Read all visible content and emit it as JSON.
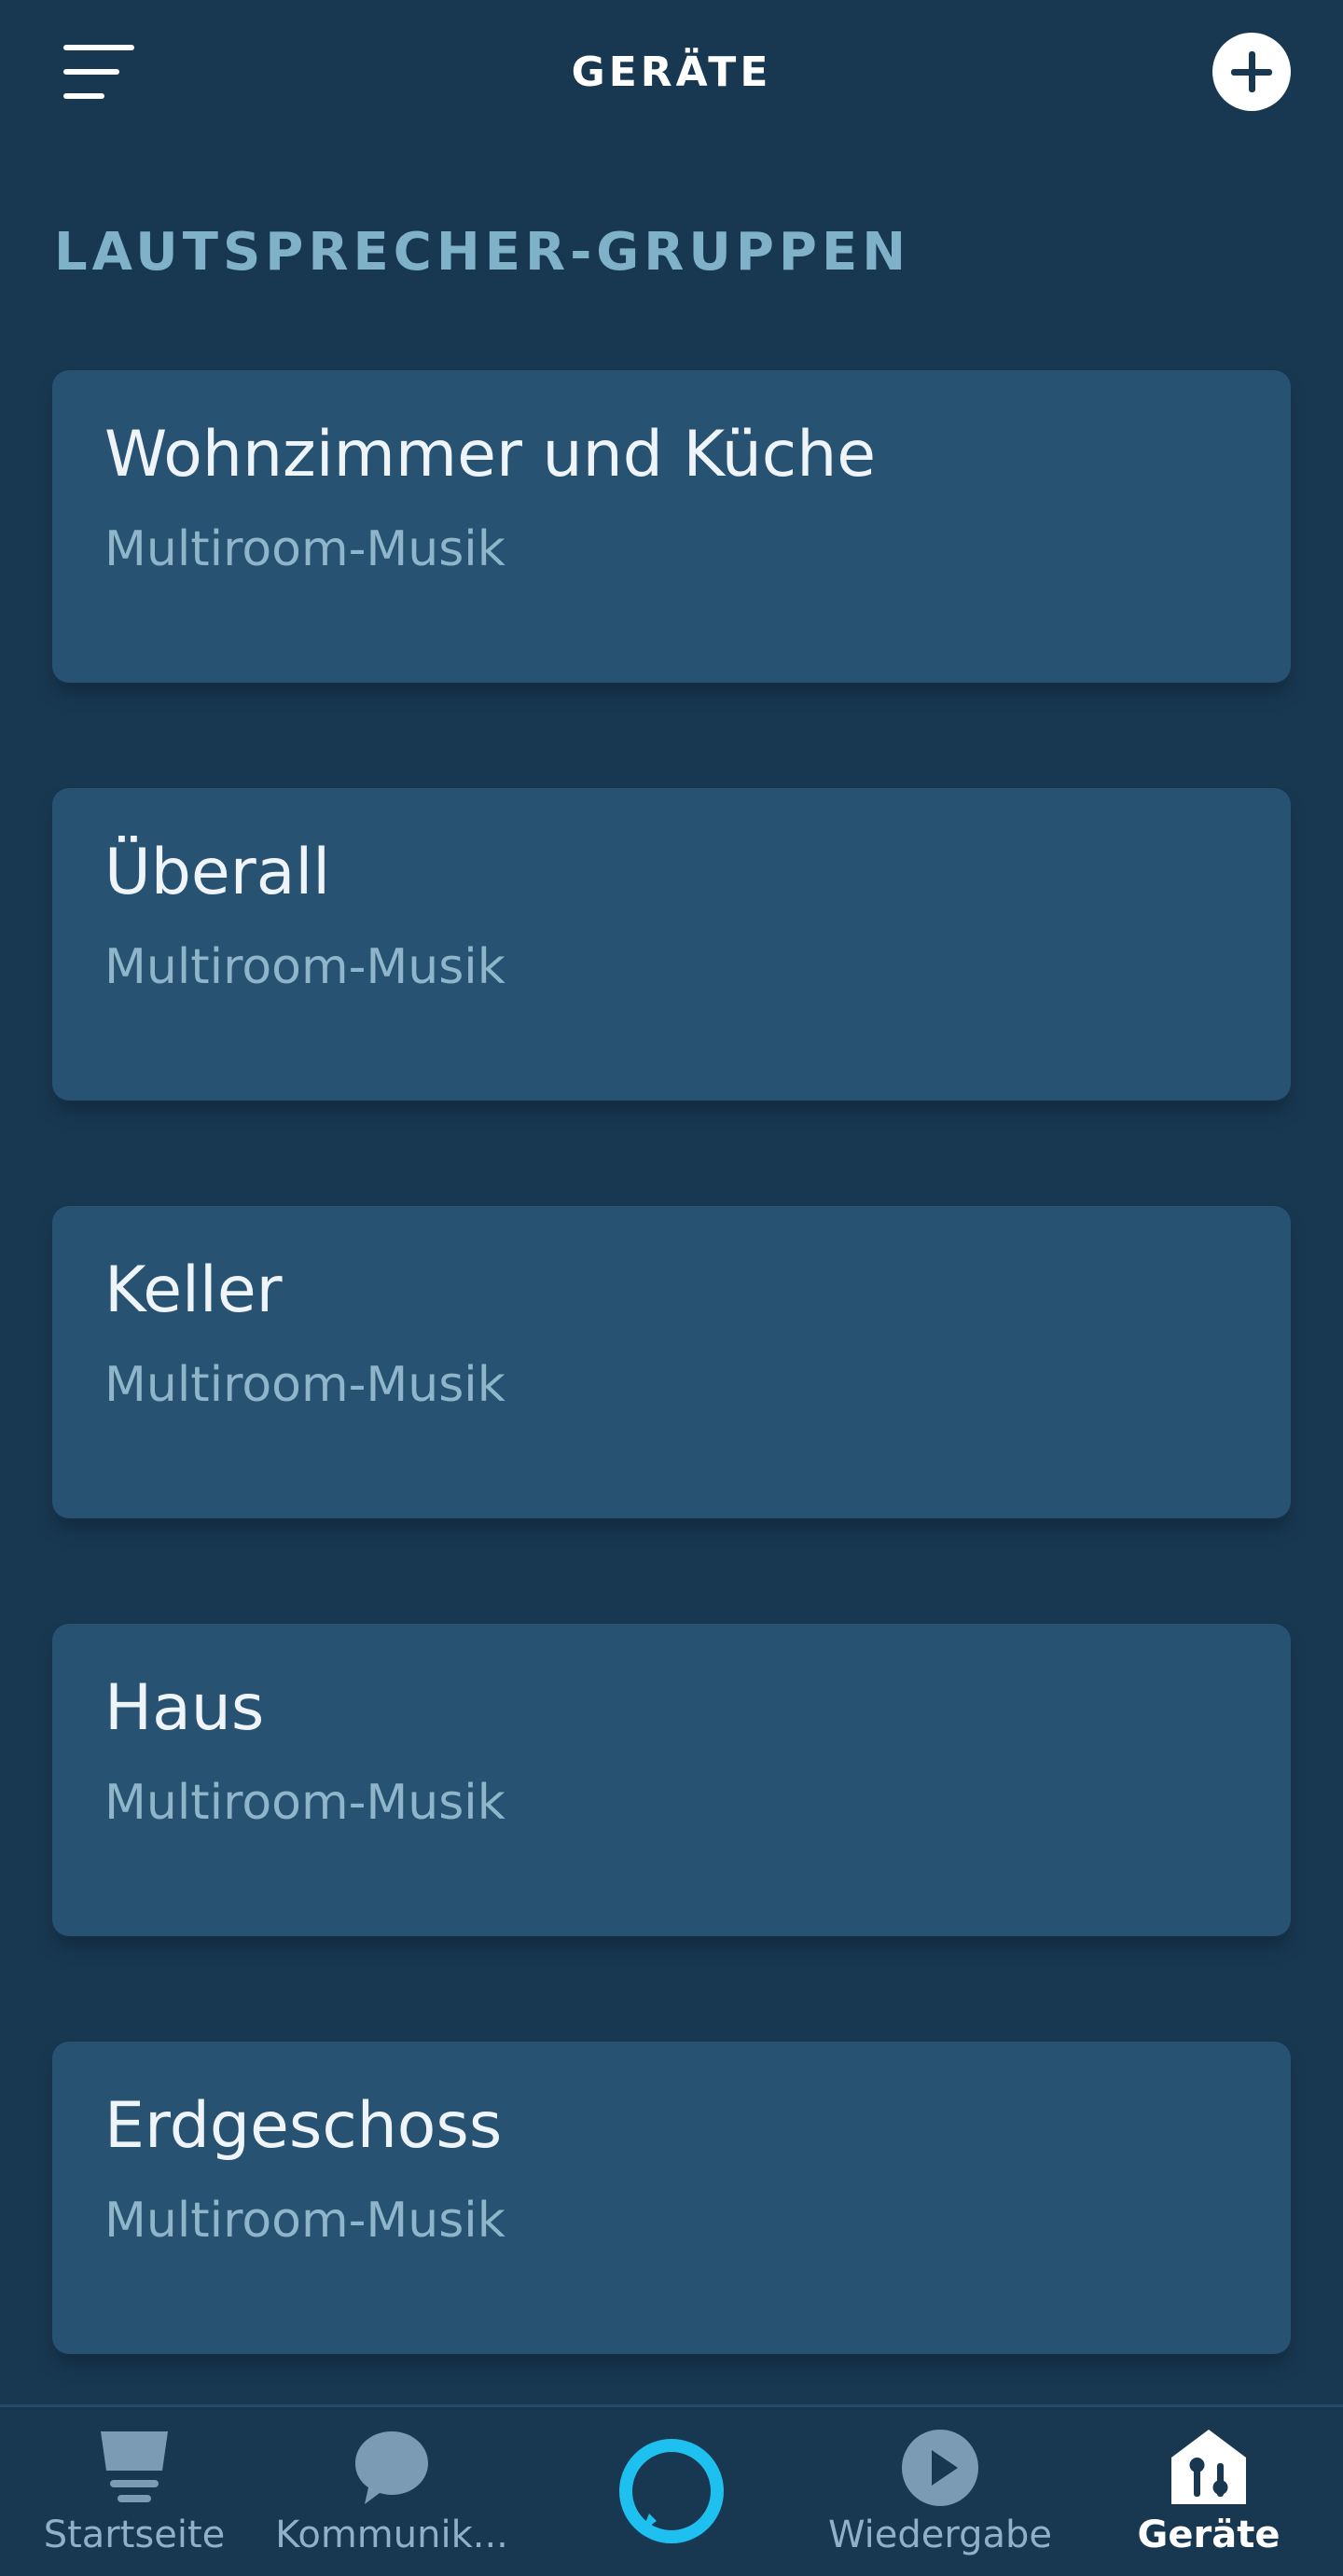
{
  "header": {
    "title": "GERÄTE",
    "menu_icon": "hamburger-menu-icon",
    "add_icon": "plus-circle-icon"
  },
  "section": {
    "title": "LAUTSPRECHER-GRUPPEN"
  },
  "groups": [
    {
      "name": "Wohnzimmer und Küche",
      "type": "Multiroom-Musik"
    },
    {
      "name": "Überall",
      "type": "Multiroom-Musik"
    },
    {
      "name": "Keller",
      "type": "Multiroom-Musik"
    },
    {
      "name": "Haus",
      "type": "Multiroom-Musik"
    },
    {
      "name": "Erdgeschoss",
      "type": "Multiroom-Musik"
    }
  ],
  "nav": {
    "items": [
      {
        "label": "Startseite",
        "icon": "home-feed-icon"
      },
      {
        "label": "Kommunik...",
        "icon": "speech-bubble-icon"
      },
      {
        "label": "",
        "icon": "alexa-ring-icon"
      },
      {
        "label": "Wiedergabe",
        "icon": "play-circle-icon"
      },
      {
        "label": "Geräte",
        "icon": "devices-house-icon"
      }
    ],
    "active": "Geräte"
  },
  "colors": {
    "background": "#183852",
    "card": "#275272",
    "section_title": "#7fb1c9",
    "subtitle": "#8fb5cb",
    "alexa_accent": "#1ec0f0"
  }
}
